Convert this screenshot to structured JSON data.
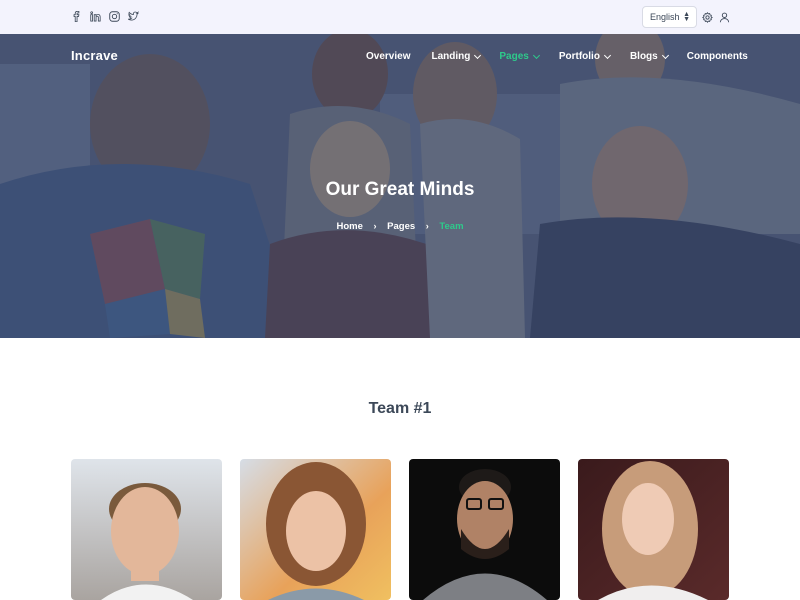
{
  "topbar": {
    "social_icons": [
      "facebook-icon",
      "linkedin-icon",
      "instagram-icon",
      "twitter-icon"
    ],
    "language": "English",
    "settings_icon": "gear-icon",
    "user_icon": "user-icon"
  },
  "header": {
    "brand": "Incrave",
    "nav": [
      {
        "label": "Overview",
        "dropdown": false,
        "active": false
      },
      {
        "label": "Landing",
        "dropdown": true,
        "active": false
      },
      {
        "label": "Pages",
        "dropdown": true,
        "active": true
      },
      {
        "label": "Portfolio",
        "dropdown": true,
        "active": false
      },
      {
        "label": "Blogs",
        "dropdown": true,
        "active": false
      },
      {
        "label": "Components",
        "dropdown": false,
        "active": false
      }
    ]
  },
  "hero": {
    "title": "Our Great Minds",
    "breadcrumb": [
      "Home",
      "Pages",
      "Team"
    ]
  },
  "team": {
    "title": "Team #1"
  },
  "colors": {
    "accent": "#2eca8b",
    "topbar_bg": "#f3f3fd",
    "hero_overlay": "#3c4868",
    "text": "#3c4858"
  }
}
